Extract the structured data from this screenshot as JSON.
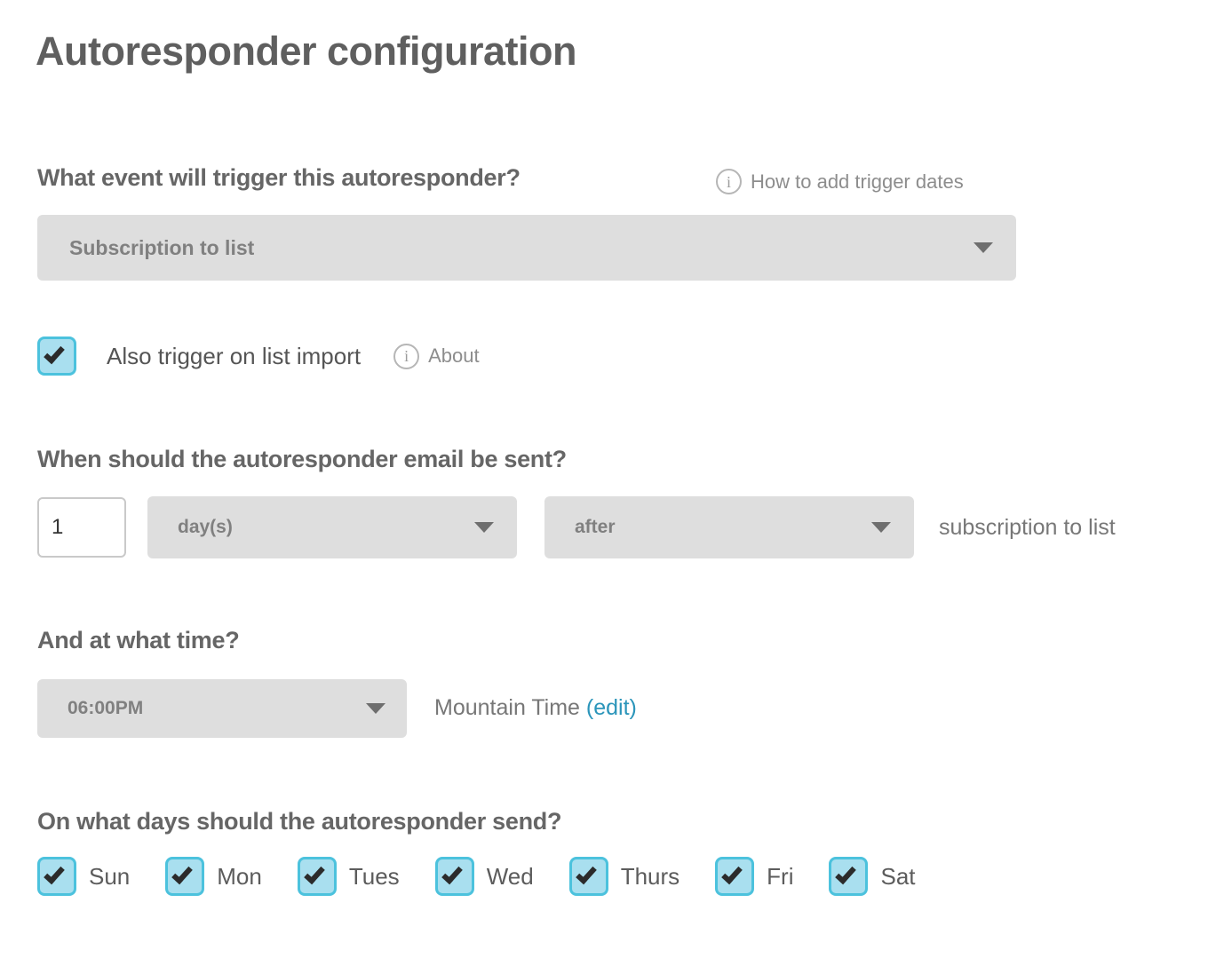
{
  "page": {
    "title": "Autoresponder configuration",
    "background_color": "#ffffff"
  },
  "colors": {
    "heading": "#666666",
    "body_text": "#777777",
    "checkbox_fill": "#a9dfef",
    "checkbox_border": "#4cc2dd",
    "select_background": "#dedede",
    "link": "#2b95ba"
  },
  "trigger_section": {
    "heading": "What event will trigger this autoresponder?",
    "info_icon": "info-circle-icon",
    "info_link_text": "How to add trigger dates",
    "select": {
      "value": "Subscription to list",
      "caret_icon": "chevron-down-icon"
    },
    "import_checkbox": {
      "checked": true,
      "label": "Also trigger on list import",
      "info_icon": "info-circle-icon",
      "info_link_text": "About"
    }
  },
  "timing_section": {
    "heading": "When should the autoresponder email be sent?",
    "amount_input": {
      "value": "1",
      "placeholder": ""
    },
    "unit_select": {
      "value": "day(s)",
      "caret_icon": "chevron-down-icon"
    },
    "relation_select": {
      "value": "after",
      "caret_icon": "chevron-down-icon"
    },
    "trailing_text": "subscription to list"
  },
  "time_section": {
    "heading": "And at what time?",
    "time_select": {
      "value": "06:00PM",
      "caret_icon": "chevron-down-icon"
    },
    "timezone_label": "Mountain Time",
    "timezone_edit_label": "(edit)"
  },
  "days_section": {
    "heading": "On what days should the autoresponder send?",
    "days": [
      {
        "label": "Sun",
        "checked": true
      },
      {
        "label": "Mon",
        "checked": true
      },
      {
        "label": "Tues",
        "checked": true
      },
      {
        "label": "Wed",
        "checked": true
      },
      {
        "label": "Thurs",
        "checked": true
      },
      {
        "label": "Fri",
        "checked": true
      },
      {
        "label": "Sat",
        "checked": true
      }
    ]
  }
}
